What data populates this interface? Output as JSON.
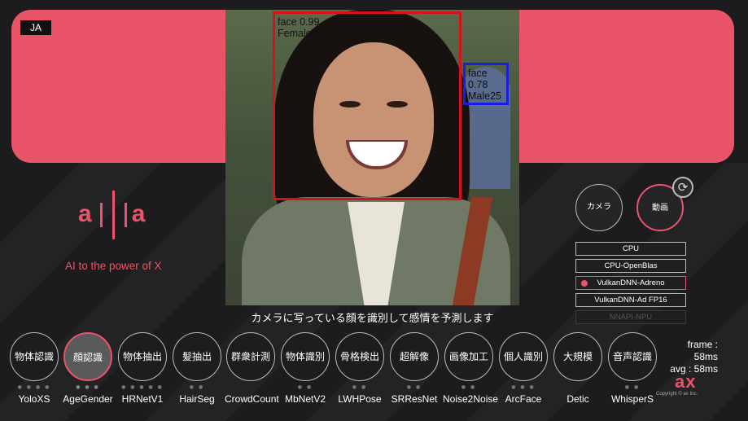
{
  "app": {
    "language_badge": "JA",
    "caption": "カメラに写っている顔を識別して感情を予測します",
    "colors": {
      "accent": "#ea5468",
      "background": "#1c1c1e",
      "detection_red": "#d3121e",
      "detection_blue": "#1a1ee0"
    }
  },
  "camera": {
    "detections": [
      {
        "label_line1": "face 0.99",
        "label_line2": "Female26",
        "color": "red"
      },
      {
        "label_line1": "face 0.78",
        "label_line2": "Male25",
        "color": "blue"
      }
    ]
  },
  "branding": {
    "logo_text": "ailia",
    "tagline": "AI to the power of X",
    "vendor_logo": "ax",
    "copyright": "Copyright © ax Inc."
  },
  "controls": {
    "camera_label": "カメラ",
    "video_label": "動画",
    "switch_icon": "refresh-icon",
    "backends": [
      {
        "label": "CPU",
        "state": "normal"
      },
      {
        "label": "CPU-OpenBlas",
        "state": "normal"
      },
      {
        "label": "VulkanDNN-Adreno",
        "state": "selected"
      },
      {
        "label": "VulkanDNN-Ad FP16",
        "state": "normal"
      },
      {
        "label": "NNAPI-NPU",
        "state": "disabled"
      }
    ]
  },
  "stats": {
    "frame": "frame : 58ms",
    "avg": "avg : 58ms"
  },
  "models": [
    {
      "category": "物体認識",
      "name": "YoloXS",
      "dots": "● ● ● ●",
      "active": false
    },
    {
      "category": "顔認識",
      "name": "AgeGender",
      "dots": "● ● ●",
      "active": true
    },
    {
      "category": "物体抽出",
      "name": "HRNetV1",
      "dots": "● ● ● ● ●",
      "active": false
    },
    {
      "category": "髪抽出",
      "name": "HairSeg",
      "dots": "● ●",
      "active": false
    },
    {
      "category": "群衆計測",
      "name": "CrowdCount",
      "dots": "",
      "active": false
    },
    {
      "category": "物体識別",
      "name": "MbNetV2",
      "dots": "● ●",
      "active": false
    },
    {
      "category": "骨格検出",
      "name": "LWHPose",
      "dots": "● ●",
      "active": false
    },
    {
      "category": "超解像",
      "name": "SRResNet",
      "dots": "● ●",
      "active": false
    },
    {
      "category": "画像加工",
      "name": "Noise2Noise",
      "dots": "● ●",
      "active": false
    },
    {
      "category": "個人識別",
      "name": "ArcFace",
      "dots": "● ● ●",
      "active": false
    },
    {
      "category": "大規模",
      "name": "Detic",
      "dots": "",
      "active": false
    },
    {
      "category": "音声認識",
      "name": "WhisperS",
      "dots": "● ●",
      "active": false
    }
  ]
}
